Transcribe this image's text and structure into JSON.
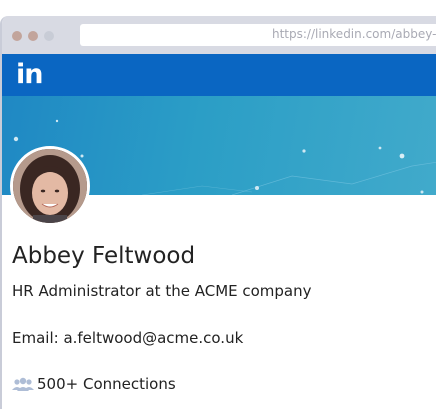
{
  "browser": {
    "url": "https://linkedin.com/abbey-"
  },
  "header": {
    "logo_text": "in",
    "brand_color": "#0a66c2"
  },
  "profile": {
    "name": "Abbey Feltwood",
    "headline": "HR Administrator at the ACME company",
    "email_line": "Email: a.feltwood@acme.co.uk",
    "connections": "500+ Connections",
    "connections_icon": "people-icon"
  },
  "colors": {
    "banner": "#2b9ec6",
    "text": "#222222"
  }
}
